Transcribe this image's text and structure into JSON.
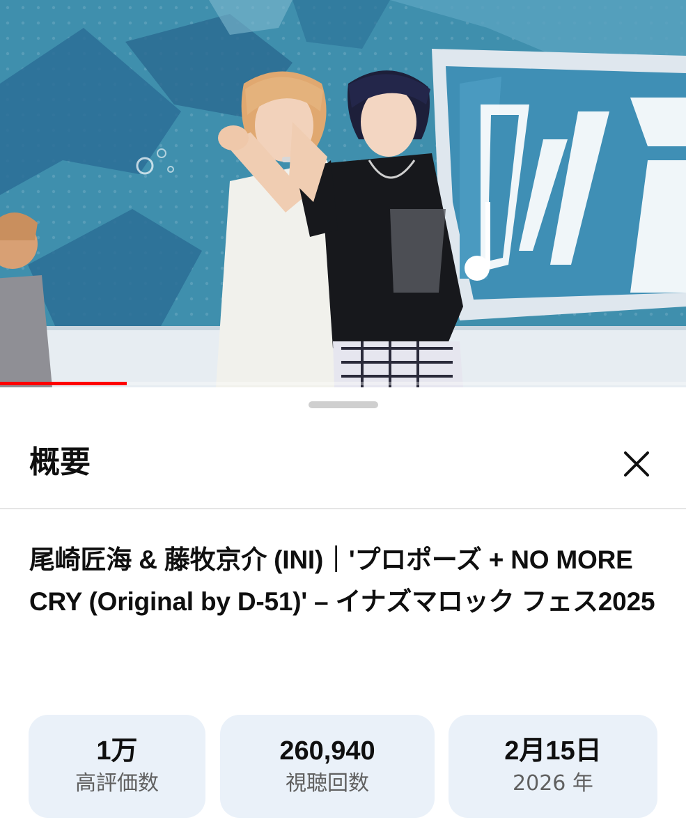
{
  "video": {
    "progress_fraction": 0.185,
    "progress_color": "#ff0000"
  },
  "sheet": {
    "title": "概要",
    "close_icon": "close-icon"
  },
  "description": {
    "video_title": "尾崎匠海 & 藤牧京介 (INI)｜'プロポーズ + NO MORE CRY (Original by D-51)' – イナズマロック フェス2025"
  },
  "stats": [
    {
      "value": "1万",
      "label": "高評価数"
    },
    {
      "value": "260,940",
      "label": "視聴回数"
    },
    {
      "value": "2月15日",
      "label": "2026 年"
    }
  ]
}
